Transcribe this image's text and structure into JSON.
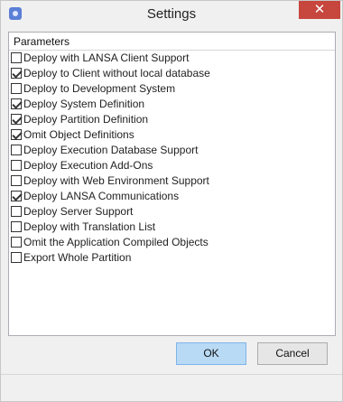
{
  "window": {
    "title": "Settings",
    "close_label": "✕"
  },
  "panel": {
    "header": "Parameters",
    "items": [
      {
        "label": "Deploy with LANSA Client Support",
        "checked": false
      },
      {
        "label": "Deploy to Client without local database",
        "checked": true
      },
      {
        "label": "Deploy to Development System",
        "checked": false
      },
      {
        "label": "Deploy System Definition",
        "checked": true
      },
      {
        "label": "Deploy Partition Definition",
        "checked": true
      },
      {
        "label": "Omit Object Definitions",
        "checked": true
      },
      {
        "label": "Deploy Execution Database Support",
        "checked": false
      },
      {
        "label": "Deploy Execution Add-Ons",
        "checked": false
      },
      {
        "label": "Deploy with Web Environment Support",
        "checked": false
      },
      {
        "label": "Deploy LANSA Communications",
        "checked": true
      },
      {
        "label": "Deploy Server Support",
        "checked": false
      },
      {
        "label": "Deploy with Translation List",
        "checked": false
      },
      {
        "label": "Omit the Application Compiled Objects",
        "checked": false
      },
      {
        "label": "Export Whole Partition",
        "checked": false
      }
    ]
  },
  "buttons": {
    "ok": "OK",
    "cancel": "Cancel"
  }
}
